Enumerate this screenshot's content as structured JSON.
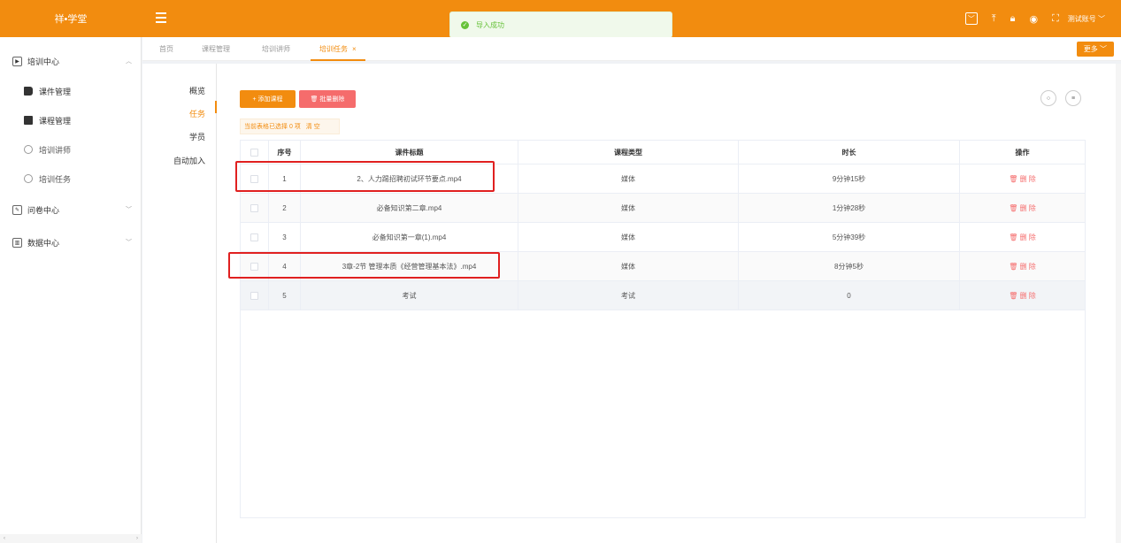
{
  "header": {
    "logo": "祥•学堂",
    "toast": "导入成功",
    "account": "测试账号 ﹀",
    "icons": [
      "dropdown-box-icon",
      "upload-icon",
      "lock-icon",
      "eye-icon",
      "fullscreen-icon"
    ]
  },
  "sidebar": {
    "groups": [
      {
        "label": "培训中心",
        "icon": "training-icon",
        "caret": "︿"
      },
      {
        "label": "问卷中心",
        "icon": "survey-icon",
        "caret": "﹀"
      },
      {
        "label": "数据中心",
        "icon": "chart-icon",
        "caret": "﹀"
      }
    ],
    "items": [
      {
        "label": "课件管理",
        "icon": "book-icon"
      },
      {
        "label": "课程管理",
        "icon": "books-icon"
      },
      {
        "label": "培训讲师",
        "icon": "lecturer-icon"
      },
      {
        "label": "培训任务",
        "icon": "clock-icon"
      }
    ]
  },
  "tabs": [
    {
      "label": "首页"
    },
    {
      "label": "课程管理"
    },
    {
      "label": "培训讲师"
    },
    {
      "label": "培训任务",
      "active": true,
      "close": "×"
    }
  ],
  "more_button": "更多 ﹀",
  "subnav": [
    "概览",
    "任务",
    "学员",
    "自动加入"
  ],
  "toolbar": {
    "add": "+ 添加课程",
    "batch_delete": "🗑 批量删除",
    "selection_info": "当前表格已选择 0 项",
    "clear": "清 空",
    "refresh_icon": "○",
    "filter_icon": "≡"
  },
  "table": {
    "headers": [
      "序号",
      "课件标题",
      "课程类型",
      "时长",
      "操作"
    ],
    "rows": [
      {
        "no": "1",
        "title": "2、人力踢招聘初试环节要点.mp4",
        "type": "媒体",
        "duration": "9分钟15秒",
        "op": "🗑 删 除"
      },
      {
        "no": "2",
        "title": "必备知识第二章.mp4",
        "type": "媒体",
        "duration": "1分钟28秒",
        "op": "🗑 删 除"
      },
      {
        "no": "3",
        "title": "必备知识第一章(1).mp4",
        "type": "媒体",
        "duration": "5分钟39秒",
        "op": "🗑 删 除"
      },
      {
        "no": "4",
        "title": "3章-2节 管理本质《经营管理基本法》.mp4",
        "type": "媒体",
        "duration": "8分钟5秒",
        "op": "🗑 删 除"
      },
      {
        "no": "5",
        "title": "考试",
        "type": "考试",
        "duration": "0",
        "op": "🗑 删 除"
      }
    ]
  },
  "sidebar_scroll": {
    "left": "‹",
    "right": "›"
  }
}
